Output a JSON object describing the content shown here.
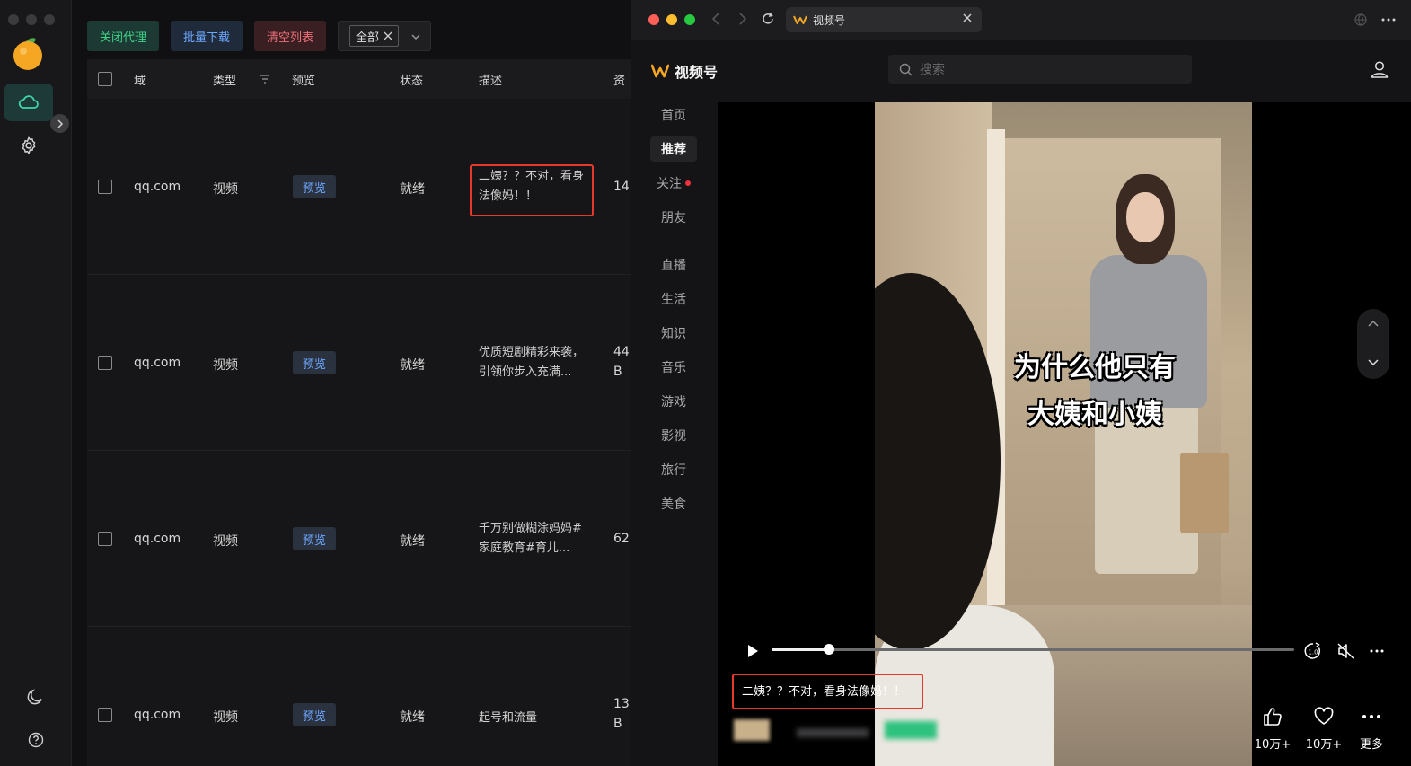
{
  "left_app": {
    "toolbar": {
      "close_proxy": "关闭代理",
      "batch_download": "批量下载",
      "clear_list": "清空列表",
      "filter_value": "全部"
    },
    "table": {
      "headers": {
        "domain": "域",
        "type": "类型",
        "preview": "预览",
        "status": "状态",
        "description": "描述",
        "resource": "资"
      },
      "rows": [
        {
          "domain": "qq.com",
          "type": "视频",
          "preview": "预览",
          "status": "就绪",
          "description": "二姨？？不对，看身法像妈！！",
          "resource_line1": "14",
          "resource_line2": "",
          "highlighted": true
        },
        {
          "domain": "qq.com",
          "type": "视频",
          "preview": "预览",
          "status": "就绪",
          "description": "优质短剧精彩来袭，引领你步入充满...",
          "resource_line1": "44",
          "resource_line2": "B",
          "highlighted": false
        },
        {
          "domain": "qq.com",
          "type": "视频",
          "preview": "预览",
          "status": "就绪",
          "description": "千万别做糊涂妈妈#家庭教育#育儿...",
          "resource_line1": "62",
          "resource_line2": "",
          "highlighted": false
        },
        {
          "domain": "qq.com",
          "type": "视频",
          "preview": "预览",
          "status": "就绪",
          "description": "起号和流量",
          "resource_line1": "13",
          "resource_line2": "B",
          "highlighted": false
        }
      ]
    }
  },
  "browser": {
    "tab_title": "视频号",
    "brand": "视频号",
    "search_placeholder": "搜索",
    "nav": [
      {
        "label": "首页",
        "active": false,
        "dot": false
      },
      {
        "label": "推荐",
        "active": true,
        "dot": false
      },
      {
        "label": "关注",
        "active": false,
        "dot": true
      },
      {
        "label": "朋友",
        "active": false,
        "dot": false
      },
      {
        "label": "直播",
        "active": false,
        "dot": false
      },
      {
        "label": "生活",
        "active": false,
        "dot": false
      },
      {
        "label": "知识",
        "active": false,
        "dot": false
      },
      {
        "label": "音乐",
        "active": false,
        "dot": false
      },
      {
        "label": "游戏",
        "active": false,
        "dot": false
      },
      {
        "label": "影视",
        "active": false,
        "dot": false
      },
      {
        "label": "旅行",
        "active": false,
        "dot": false
      },
      {
        "label": "美食",
        "active": false,
        "dot": false
      }
    ],
    "video": {
      "caption_line1": "为什么他只有",
      "caption_line2": "大姨和小姨",
      "description": "二姨？？不对，看身法像妈！！",
      "progress_fraction": 0.11,
      "likes": "10万+",
      "favorites": "10万+",
      "more": "更多"
    }
  },
  "colors": {
    "accent_green": "#3fd38a",
    "accent_blue": "#6ea8ff",
    "accent_red": "#f0707a",
    "highlight_red": "#e53a2b",
    "brand_orange": "#f5a623"
  }
}
